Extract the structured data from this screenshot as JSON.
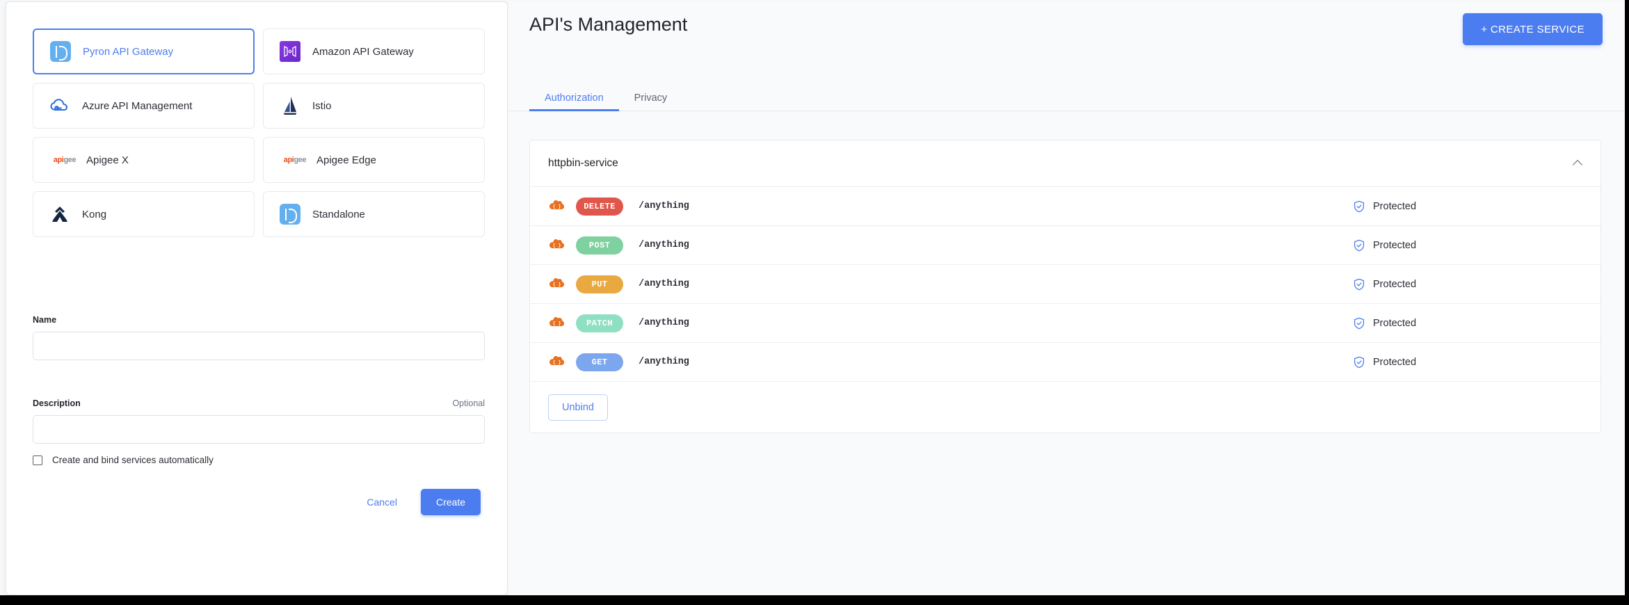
{
  "dialog": {
    "providers": [
      {
        "label": "Pyron API Gateway",
        "icon": "pyron-logo-icon",
        "selected": true
      },
      {
        "label": "Amazon API Gateway",
        "icon": "amazon-api-gateway-logo-icon",
        "selected": false
      },
      {
        "label": "Azure API Management",
        "icon": "azure-cloud-logo-icon",
        "selected": false
      },
      {
        "label": "Istio",
        "icon": "istio-sail-logo-icon",
        "selected": false
      },
      {
        "label": "Apigee X",
        "icon": "apigee-wordmark-icon",
        "selected": false
      },
      {
        "label": "Apigee Edge",
        "icon": "apigee-wordmark-icon",
        "selected": false
      },
      {
        "label": "Kong",
        "icon": "kong-gorilla-logo-icon",
        "selected": false
      },
      {
        "label": "Standalone",
        "icon": "standalone-logo-icon",
        "selected": false
      }
    ],
    "name_field": {
      "label": "Name",
      "value": "",
      "placeholder": ""
    },
    "description_field": {
      "label": "Description",
      "optional": "Optional",
      "value": "",
      "placeholder": ""
    },
    "auto_bind": {
      "label": "Create and bind services automatically",
      "checked": false
    },
    "cancel_label": "Cancel",
    "create_label": "Create"
  },
  "main": {
    "title": "API's Management",
    "create_service_label": "+ CREATE SERVICE",
    "tabs": [
      {
        "label": "Authorization",
        "active": true
      },
      {
        "label": "Privacy",
        "active": false
      }
    ],
    "service": {
      "name": "httpbin-service",
      "collapse_icon": "chevron-up-icon",
      "unbind_label": "Unbind",
      "endpoints": [
        {
          "icon": "json-cloud-icon",
          "method": "DELETE",
          "path": "/anything",
          "status": "Protected",
          "status_icon": "shield-check-icon",
          "color": "#e0564b"
        },
        {
          "icon": "json-cloud-icon",
          "method": "POST",
          "path": "/anything",
          "status": "Protected",
          "status_icon": "shield-check-icon",
          "color": "#7fd1a0"
        },
        {
          "icon": "json-cloud-icon",
          "method": "PUT",
          "path": "/anything",
          "status": "Protected",
          "status_icon": "shield-check-icon",
          "color": "#e8a940"
        },
        {
          "icon": "json-cloud-icon",
          "method": "PATCH",
          "path": "/anything",
          "status": "Protected",
          "status_icon": "shield-check-icon",
          "color": "#8fdfc2"
        },
        {
          "icon": "json-cloud-icon",
          "method": "GET",
          "path": "/anything",
          "status": "Protected",
          "status_icon": "shield-check-icon",
          "color": "#7ca7ee"
        }
      ]
    }
  },
  "colors": {
    "accent": "#4c7df0",
    "json_icon": "#e8701f",
    "shield": "#4c7df0"
  }
}
